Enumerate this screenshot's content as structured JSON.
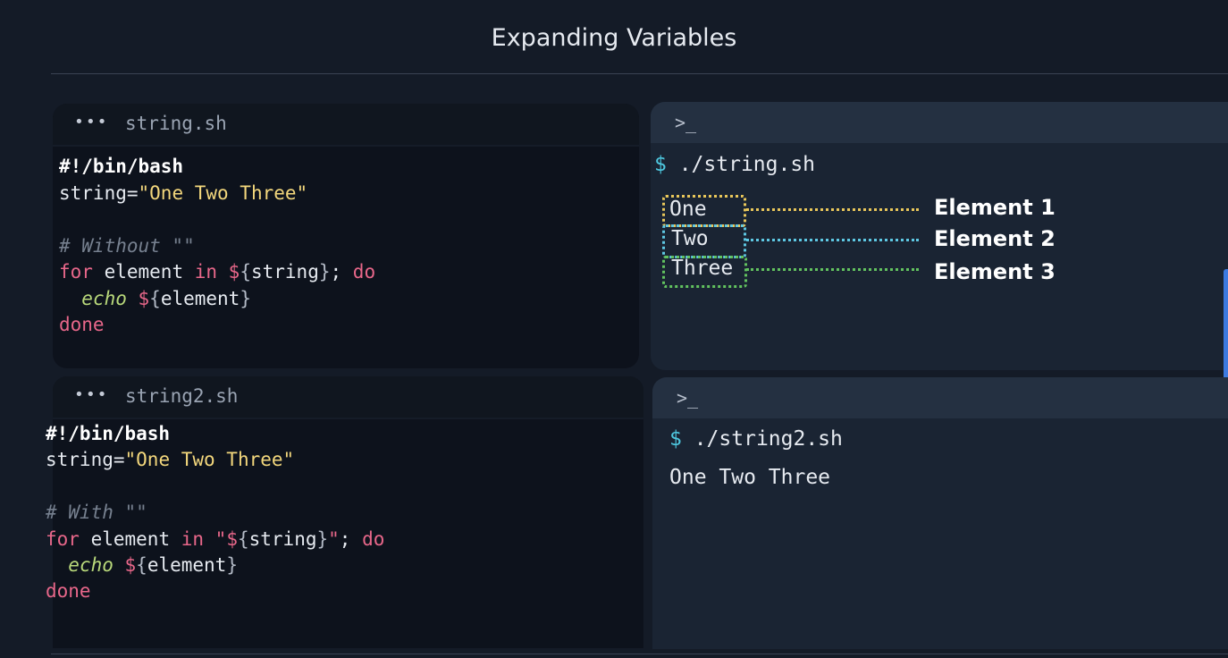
{
  "slide": {
    "title": "Expanding Variables"
  },
  "editor1": {
    "dots": "•••",
    "filename": "string.sh",
    "shebang": "#!/bin/bash",
    "assign_var": "string=",
    "assign_val": "\"One Two Three\"",
    "comment": "# Without \"\"",
    "kw_for": "for",
    "element": " element ",
    "kw_in": "in",
    "dollar": " $",
    "open_brace": "{",
    "var_string": "string",
    "close_brace": "}",
    "semicolon": "; ",
    "kw_do": "do",
    "indent": "  ",
    "echo": "echo",
    "dollar2": " $",
    "var_element": "element",
    "kw_done": "done"
  },
  "editor2": {
    "dots": "•••",
    "filename": "string2.sh",
    "shebang": "#!/bin/bash",
    "assign_var": "string=",
    "assign_val": "\"One Two Three\"",
    "comment": "# With \"\"",
    "kw_for": "for",
    "element": " element ",
    "kw_in": "in",
    "quote_dollar": " \"$",
    "open_brace": "{",
    "var_string": "string",
    "close_brace": "}",
    "quote_close": "\"",
    "semicolon": "; ",
    "kw_do": "do",
    "indent": "  ",
    "echo": "echo",
    "dollar2": " $",
    "var_element": "element",
    "kw_done": "done"
  },
  "terminal1": {
    "icon": ">_",
    "prompt": "$",
    "command": " ./string.sh",
    "words": [
      "One",
      "Two",
      "Three"
    ],
    "labels": [
      "Element 1",
      "Element 2",
      "Element 3"
    ],
    "colors": [
      "#e8c65a",
      "#5ec8e3",
      "#62c25f"
    ]
  },
  "terminal2": {
    "icon": ">_",
    "prompt": "$",
    "command": " ./string2.sh",
    "output": "One Two Three"
  }
}
